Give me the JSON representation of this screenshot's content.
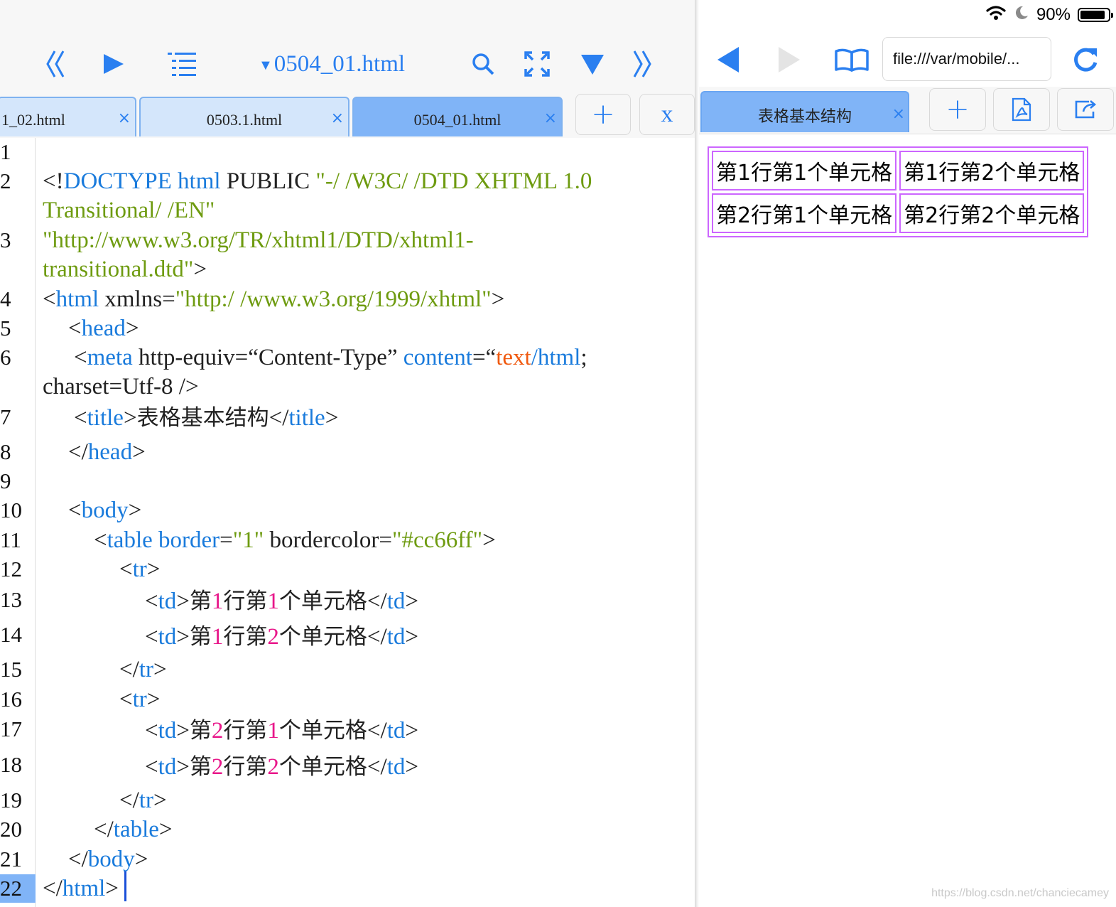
{
  "editor": {
    "file_title": "0504_01.html",
    "tabs": [
      {
        "label": "1_02.html",
        "close": "×"
      },
      {
        "label": "0503.1.html",
        "close": "×"
      },
      {
        "label": "0504_01.html",
        "close": "×"
      }
    ],
    "new_tab_label": "+",
    "close_all_label": "x",
    "current_line": 22,
    "lines": {
      "l2a": "<!",
      "l2b": "DOCTYPE html",
      "l2c": " PUBLIC ",
      "l2d": "\"-/ /W3C/ /DTD XHTML 1.0",
      "l2e": "Transitional/ /EN\"",
      "l3a": "\"http://www.w3.org/TR/xhtml1/DTD/xhtml1-",
      "l3b": "transitional.dtd\"",
      "l3c": ">",
      "l4a": "<",
      "l4b": "html",
      "l4c": " xmlns=",
      "l4d": "\"http:/ /www.w3.org/1999/xhtml\"",
      "l4e": ">",
      "l5a": "<",
      "l5b": "head",
      "l5c": ">",
      "l6a": "<",
      "l6b": "meta",
      "l6c": " http-equiv=“Content-Type” ",
      "l6d": "content",
      "l6e": "=“",
      "l6f": "text",
      "l6g": "/html",
      "l6h": ";",
      "l6i": "charset=Utf-8 />",
      "l7a": "<",
      "l7b": "title",
      "l7c": ">",
      "l7d": "表格基本结构",
      "l7e": "</",
      "l7f": "title",
      "l7g": ">",
      "l8a": "</",
      "l8b": "head",
      "l8c": ">",
      "l10a": "<",
      "l10b": "body",
      "l10c": ">",
      "l11a": "<",
      "l11b": "table border",
      "l11c": "=",
      "l11d": "\"1\"",
      "l11e": " bordercolor=",
      "l11f": "\"#cc66ff\"",
      "l11g": ">",
      "l12a": "<",
      "l12b": "tr",
      "l12c": ">",
      "td_open_a": "<",
      "td_open_b": "td",
      "td_open_c": ">",
      "td_close_a": "</",
      "td_close_b": "td",
      "td_close_c": ">",
      "di": "第",
      "hang": "行",
      "ge": "个单元格",
      "n1": "1",
      "n2": "2",
      "l15a": "</",
      "l15b": "tr",
      "l15c": ">",
      "l20a": "</",
      "l20b": "table",
      "l20c": ">",
      "l21a": "</",
      "l21b": "body",
      "l21c": ">",
      "l22a": "</",
      "l22b": "html",
      "l22c": ">"
    }
  },
  "browser": {
    "status": {
      "battery_text": "90%",
      "battery_level": 0.9
    },
    "url": "file:///var/mobile/...",
    "tab": {
      "label": "表格基本结构",
      "close": "×"
    },
    "new_tab_label": "+",
    "table": [
      [
        "第1行第1个单元格",
        "第1行第2个单元格"
      ],
      [
        "第2行第1个单元格",
        "第2行第2个单元格"
      ]
    ]
  },
  "watermark": "https://blog.csdn.net/chanciecamey",
  "colors": {
    "accent": "#2a7ff0",
    "table_border": "#cc66ff",
    "active_tab": "#80b4f7"
  }
}
